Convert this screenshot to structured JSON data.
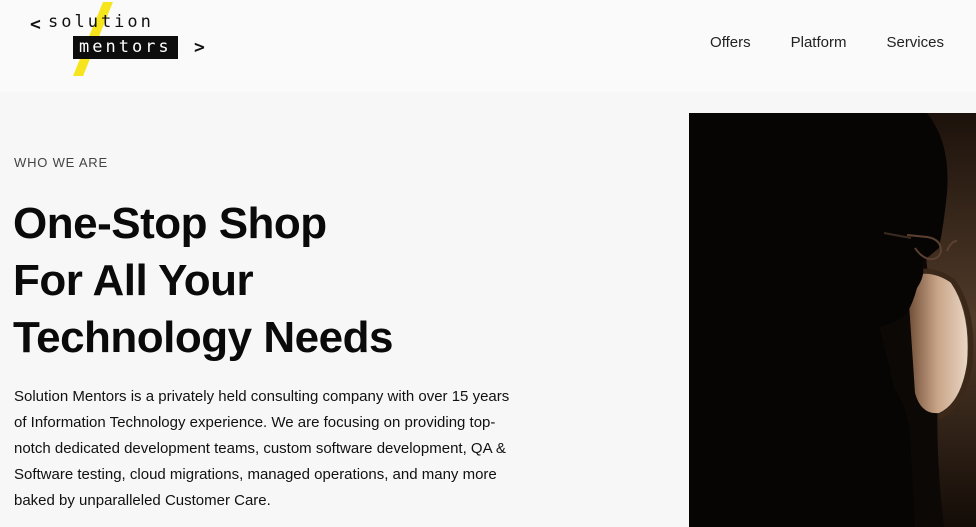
{
  "logo": {
    "left_bracket": "<",
    "word_top": "solution",
    "word_bottom": "mentors",
    "right_bracket": ">",
    "accent_color": "#f6e51c"
  },
  "nav": {
    "items": [
      {
        "label": "Offers"
      },
      {
        "label": "Platform"
      },
      {
        "label": "Services"
      }
    ]
  },
  "hero": {
    "eyebrow": "WHO WE ARE",
    "headline_lines": [
      "One-Stop Shop",
      "For All Your",
      "Technology Needs"
    ],
    "body": "Solution Mentors is a privately held consulting company with over 15 years of Information Technology experience. We are focusing on providing top-notch dedicated development teams, custom software development, QA & Software testing, cloud migrations, managed operations, and many more baked by unparalleled Customer Care."
  }
}
